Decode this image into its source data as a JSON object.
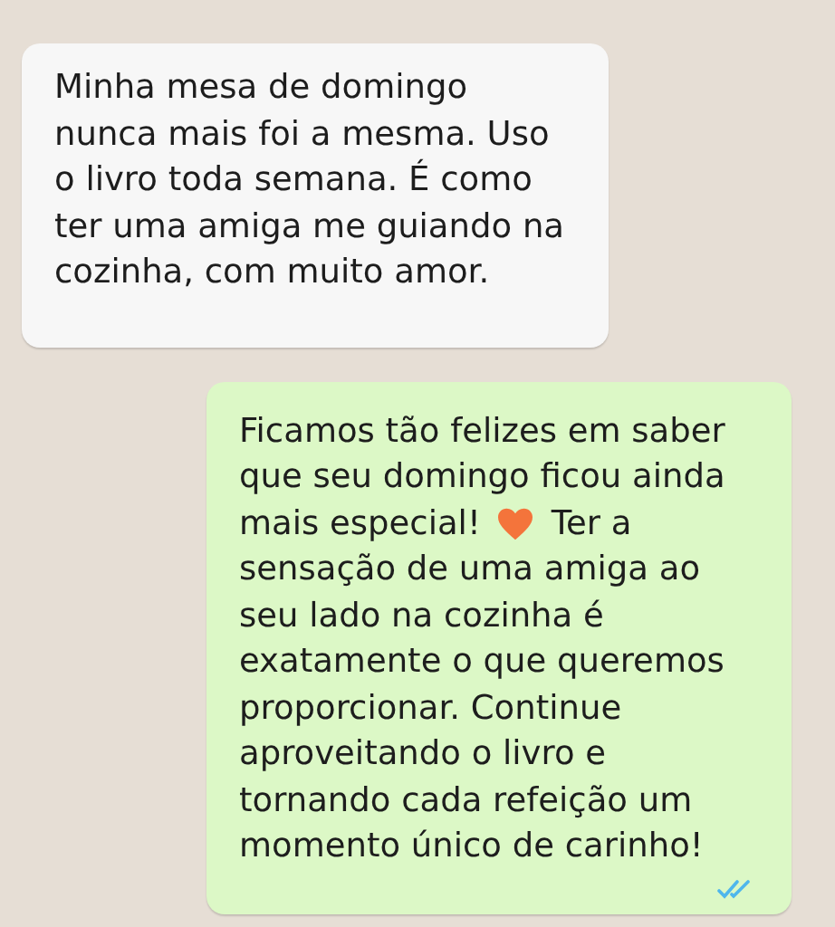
{
  "messages": [
    {
      "outgoing": false,
      "lines": [
        [
          "Minha mesa de domingo"
        ],
        [
          "nunca mais foi a mesma. Uso"
        ],
        [
          "o livro toda semana. É como"
        ],
        [
          "ter uma amiga me guiando na"
        ],
        [
          "cozinha, com muito amor."
        ]
      ]
    },
    {
      "outgoing": true,
      "read": true,
      "lines": [
        [
          "Ficamos tão felizes em saber"
        ],
        [
          "que seu domingo ficou ainda"
        ],
        [
          "mais especial!",
          {
            "kind": "heart"
          },
          "Ter a"
        ],
        [
          "sensação de uma amiga ao"
        ],
        [
          "seu lado na cozinha é"
        ],
        [
          "exatamente o que queremos"
        ],
        [
          "proporcionar. Continue"
        ],
        [
          "aproveitando o livro e"
        ],
        [
          "tornando cada refeição um"
        ],
        [
          "momento único de carinho!"
        ]
      ]
    }
  ]
}
